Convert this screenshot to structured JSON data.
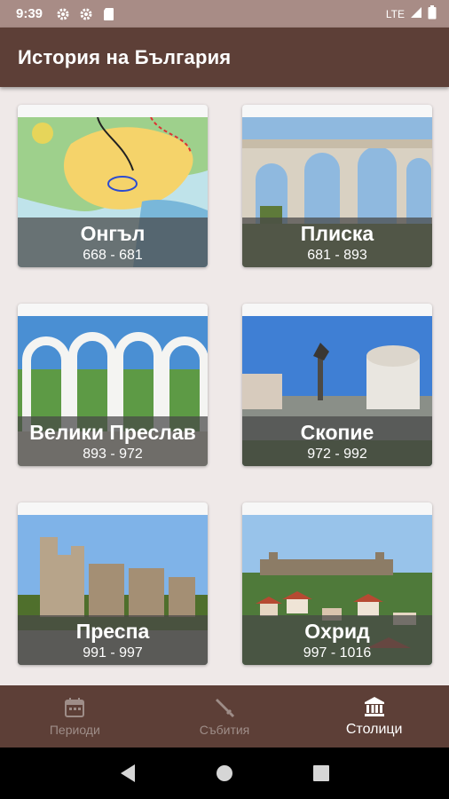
{
  "status_bar": {
    "time": "9:39",
    "network": "LTE"
  },
  "app_bar": {
    "title": "История на България"
  },
  "cards": [
    {
      "name": "Онгъл",
      "years": "668 - 681"
    },
    {
      "name": "Плиска",
      "years": "681 - 893"
    },
    {
      "name": "Велики Преслав",
      "years": "893 - 972"
    },
    {
      "name": "Скопие",
      "years": "972 - 992"
    },
    {
      "name": "Преспа",
      "years": "991 - 997"
    },
    {
      "name": "Охрид",
      "years": "997 - 1016"
    }
  ],
  "bottom_nav": {
    "items": [
      {
        "label": "Периоди",
        "icon": "calendar-icon",
        "active": false
      },
      {
        "label": "Събития",
        "icon": "sword-icon",
        "active": false
      },
      {
        "label": "Столици",
        "icon": "museum-icon",
        "active": true
      }
    ]
  },
  "colors": {
    "primary": "#5d3f37",
    "status_bar": "#a88c86",
    "background": "#efe9e8"
  }
}
